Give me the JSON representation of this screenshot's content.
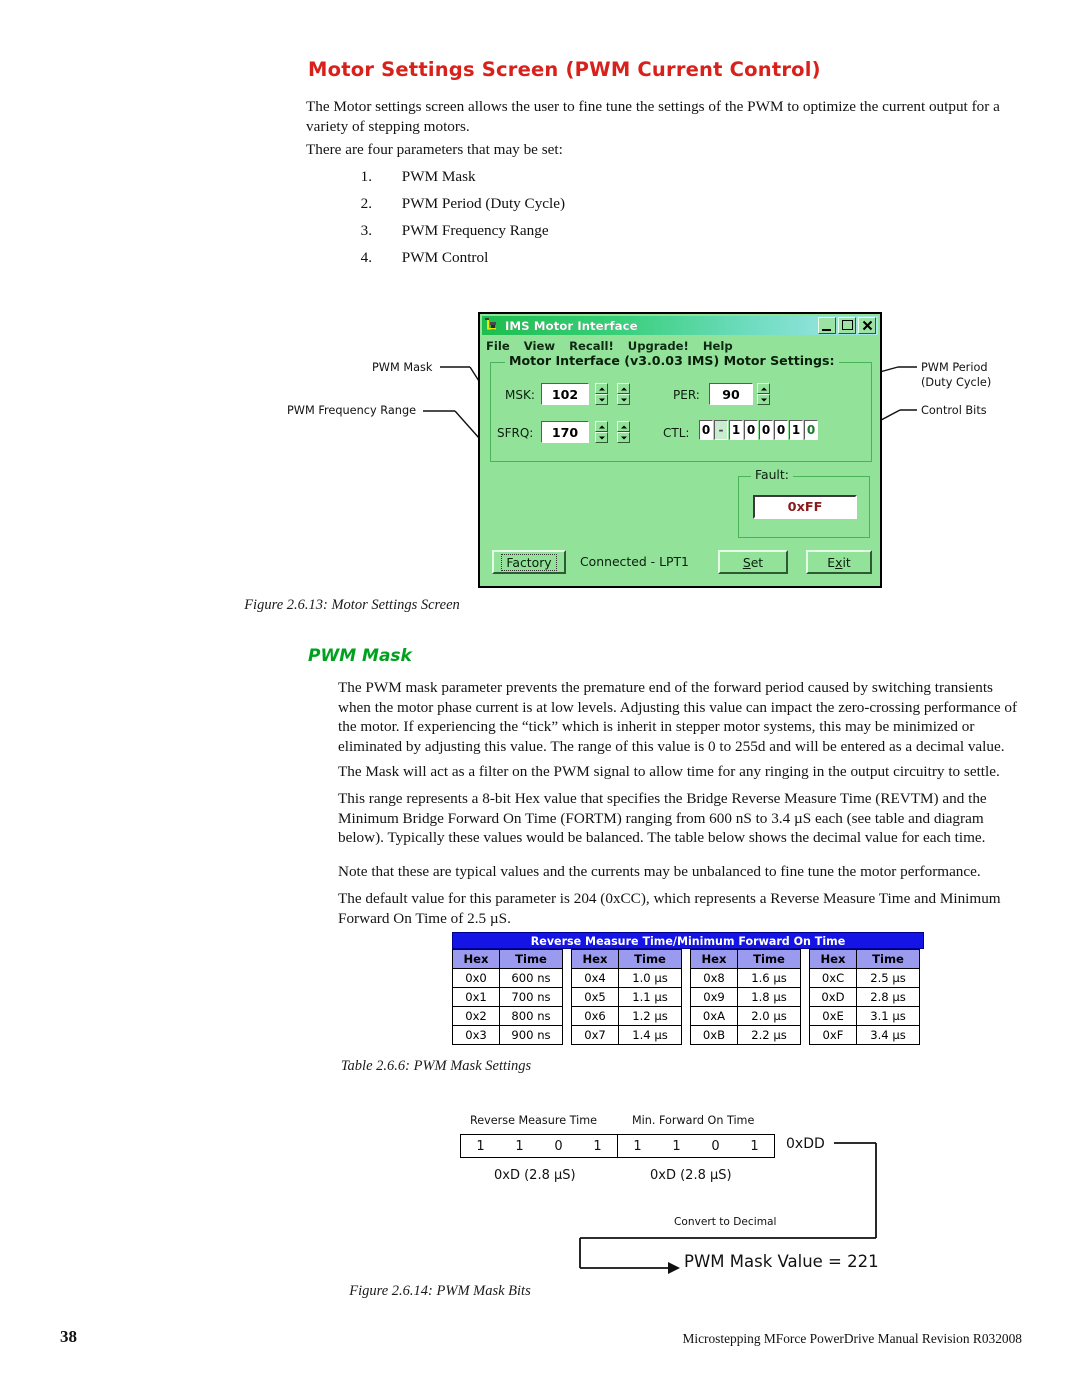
{
  "page": {
    "number": "38",
    "footer": "Microstepping MForce PowerDrive Manual Revision R032008"
  },
  "heading": "Motor Settings Screen (PWM Current Control)",
  "intro": "The Motor settings screen allows the user to fine tune the settings of the PWM to optimize the current output for a variety of stepping motors.",
  "four_params_lead": "There are four parameters that may be set:",
  "params": [
    {
      "num": "1.",
      "label": "PWM Mask"
    },
    {
      "num": "2.",
      "label": "PWM Period (Duty Cycle)"
    },
    {
      "num": "3.",
      "label": "PWM Frequency Range"
    },
    {
      "num": "4.",
      "label": "PWM Control"
    }
  ],
  "callouts": {
    "pwm_mask": "PWM Mask",
    "pwm_freq_range": "PWM Frequency Range",
    "pwm_period": "PWM Period",
    "duty_cycle": "(Duty Cycle)",
    "control_bits": "Control Bits"
  },
  "dialog": {
    "title": "IMS Motor Interface",
    "window_buttons": {
      "minimize": "_",
      "maximize": "□",
      "close": "×"
    },
    "menu": [
      "File",
      "View",
      "Recall!",
      "Upgrade!",
      "Help"
    ],
    "group_legend": "Motor Interface (v3.0.03 IMS) Motor Settings:",
    "fields": {
      "msk_label": "MSK:",
      "msk_value": "102",
      "sfrq_label": "SFRQ:",
      "sfrq_value": "170",
      "per_label": "PER:",
      "per_value": "90",
      "ctl_label": "CTL:",
      "ctl_bits": [
        "0",
        "-",
        "1",
        "0",
        "0",
        "0",
        "1",
        "0"
      ]
    },
    "fault_legend": "Fault:",
    "fault_value": "0xFF",
    "buttons": {
      "factory": "Factory",
      "set_pre": "S",
      "set_post": "et",
      "exit_pre": "E",
      "exit_mid": "x",
      "exit_post": "it"
    },
    "status": "Connected - LPT1"
  },
  "captions": {
    "figure_213": "Figure 2.6.13: Motor Settings Screen",
    "table_266": "Table 2.6.6: PWM Mask Settings",
    "figure_214": "Figure 2.6.14: PWM Mask Bits"
  },
  "section": {
    "subheading": "PWM Mask",
    "p1": "The PWM mask parameter prevents the premature end of the forward period caused by switching transients when the motor phase current is at low levels. Adjusting this value can impact the zero-crossing performance of the motor. If experiencing the “tick” which is inherit in stepper motor systems, this may be minimized or eliminated by adjusting this value. The range of this value is 0 to 255d and will be entered as a decimal value.",
    "p2": "The Mask will act as a filter on the PWM signal to allow time for any ringing in the output circuitry to settle.",
    "p3": "This range represents a 8-bit Hex value that specifies the Bridge Reverse Measure Time (REVTM) and the Minimum Bridge Forward On Time (FORTM) ranging from 600 nS to 3.4 µS each (see table and diagram below). Typically these values would be balanced. The table below shows the decimal value for each time.",
    "p4": "Note that these are typical values and the currents may be unbalanced to fine tune the motor performance.",
    "p5": "The default value for this parameter is 204 (0xCC), which represents a Reverse Measure Time and Minimum Forward On Time of 2.5 µS."
  },
  "hex_table": {
    "band_title": "Reverse Measure Time/Minimum Forward On Time",
    "columns": [
      "Hex",
      "Time"
    ],
    "blocks": [
      {
        "rows": [
          [
            "0x0",
            "600 ns"
          ],
          [
            "0x1",
            "700 ns"
          ],
          [
            "0x2",
            "800 ns"
          ],
          [
            "0x3",
            "900 ns"
          ]
        ]
      },
      {
        "rows": [
          [
            "0x4",
            "1.0 µs"
          ],
          [
            "0x5",
            "1.1 µs"
          ],
          [
            "0x6",
            "1.2 µs"
          ],
          [
            "0x7",
            "1.4 µs"
          ]
        ]
      },
      {
        "rows": [
          [
            "0x8",
            "1.6 µs"
          ],
          [
            "0x9",
            "1.8 µs"
          ],
          [
            "0xA",
            "2.0 µs"
          ],
          [
            "0xB",
            "2.2 µs"
          ]
        ]
      },
      {
        "rows": [
          [
            "0xC",
            "2.5 µs"
          ],
          [
            "0xD",
            "2.8 µs"
          ],
          [
            "0xE",
            "3.1 µs"
          ],
          [
            "0xF",
            "3.4 µs"
          ]
        ]
      }
    ]
  },
  "bit_diagram": {
    "label_reverse": "Reverse Measure Time",
    "label_forward": "Min. Forward On Time",
    "nibble_high": [
      "1",
      "1",
      "0",
      "1"
    ],
    "nibble_low": [
      "1",
      "1",
      "0",
      "1"
    ],
    "hex_sum": "0xDD",
    "sub_high": "0xD (2.8 µS)",
    "sub_low": "0xD (2.8 µS)",
    "convert_label": "Convert to Decimal",
    "result": "PWM Mask Value = 221"
  },
  "colors": {
    "heading_red": "#d9211c",
    "subheading_green": "#00a11e",
    "dialog_face": "#93e29a",
    "table_band_blue": "#1414e6",
    "table_header_periwinkle": "#9a9aee",
    "fault_red": "#8b1a1a"
  }
}
